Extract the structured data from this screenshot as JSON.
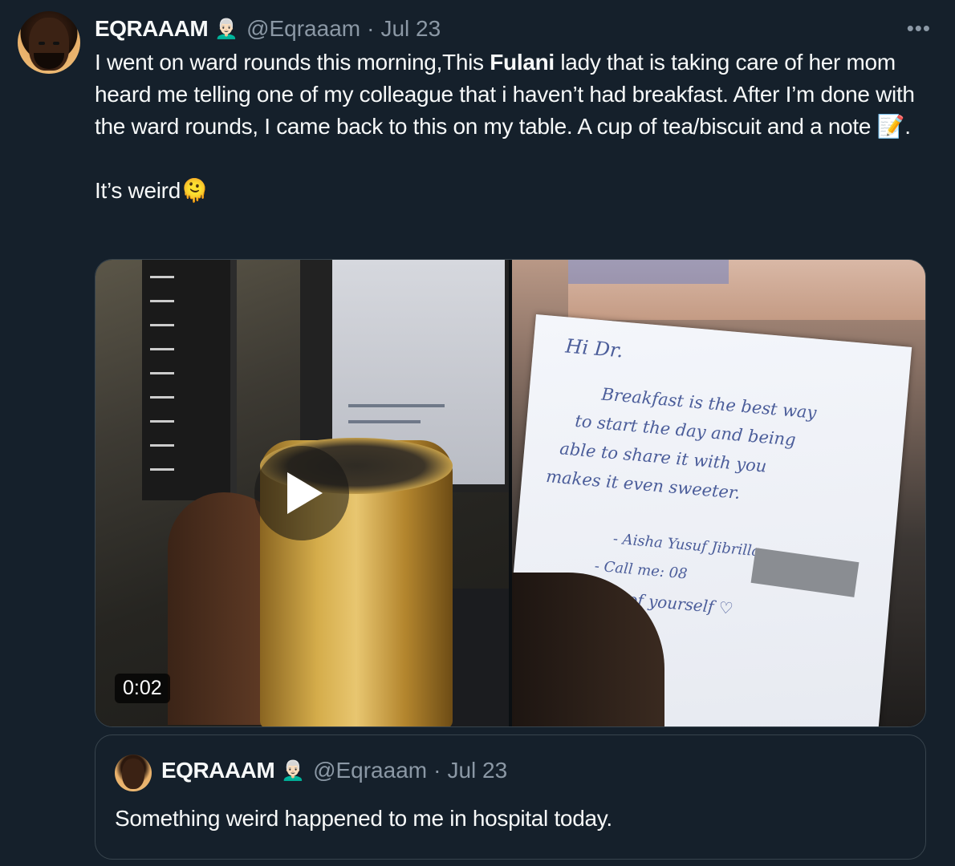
{
  "tweet": {
    "display_name": "EQRAAAM",
    "badge_emoji": "👨🏻‍🦳",
    "handle": "@Eqraaam",
    "separator": "·",
    "date": "Jul 23",
    "more_label": "•••",
    "text_part1": "I went on ward rounds this morning,This ",
    "text_bold": "Fulani",
    "text_part2": " lady that is taking care of her mom heard me telling one of my colleague that i haven’t had breakfast. After I’m done with the ward rounds, I came back to this on my table. A cup of tea/biscuit and a note ",
    "note_emoji": "📝",
    "text_part3": ".",
    "second_paragraph": "It’s weird",
    "weird_emoji": "🫠"
  },
  "media": {
    "video_duration": "0:02",
    "note_lines": {
      "greeting": "Hi Dr.",
      "line1": "Breakfast is the best way",
      "line2": "to start the day and being",
      "line3": "able to share it with you",
      "line4": "makes it even sweeter.",
      "signature": "- Aisha Yusuf Jibrilla",
      "call": "- Call me: 08",
      "closing": "Take care of yourself ♡"
    }
  },
  "quoted_tweet": {
    "display_name": "EQRAAAM",
    "badge_emoji": "👨🏻‍🦳",
    "handle": "@Eqraaam",
    "separator": "·",
    "date": "Jul 23",
    "text": "Something weird happened to me in hospital today."
  }
}
